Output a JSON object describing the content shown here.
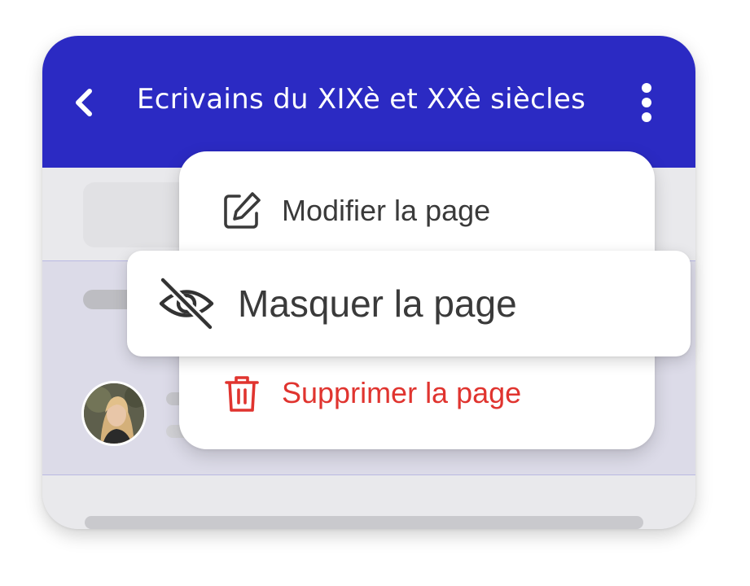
{
  "header": {
    "title": "Ecrivains du XIXè et XXè siècles",
    "back_icon": "chevron-left-icon",
    "more_icon": "more-vertical-icon",
    "background_color": "#2b2ac3"
  },
  "context_menu": {
    "items": [
      {
        "label": "Modifier la page",
        "icon": "edit-icon",
        "color": "#3a3a3a"
      },
      {
        "label": "Masquer la page",
        "icon": "eye-off-icon",
        "color": "#3a3a3a",
        "highlighted": true
      },
      {
        "label": "Supprimer la page",
        "icon": "trash-icon",
        "color": "#e0342f"
      }
    ]
  },
  "colors": {
    "danger": "#e0342f",
    "selection_band": "#dcdbe8",
    "selection_border": "#b9b8e2"
  }
}
